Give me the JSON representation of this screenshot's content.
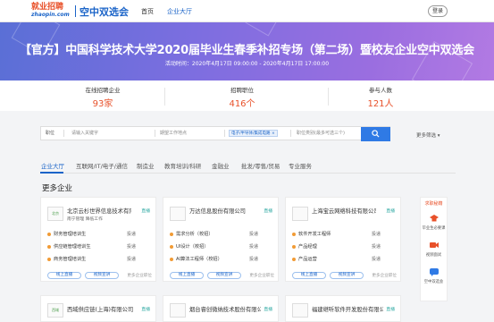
{
  "header": {
    "logo_top": "就业招聘",
    "logo_bottom": "zhaopin.com",
    "site_title": "空中双选会",
    "nav": [
      "首页",
      "企业大厅"
    ],
    "login": "登录"
  },
  "banner": {
    "title": "【官方】中国科学技术大学2020届毕业生春季补招专场（第二场）暨校友企业空中双选会",
    "time": "活动时间：2020年4月17日 09:00:00 - 2020年4月17日 17:00:00"
  },
  "stats": [
    {
      "label": "在线招聘企业",
      "value": "93家"
    },
    {
      "label": "招聘职位",
      "value": "416个"
    },
    {
      "label": "参与人数",
      "value": "121人"
    }
  ],
  "search": {
    "field1": "职位",
    "placeholder": "请输入关键字",
    "field2": "期望工作地点",
    "tag": "电子/半导体/集成电路",
    "tag_close": "×",
    "field3": "职位类别(最多可选三个)",
    "more_filter": "更多筛选"
  },
  "tabs": [
    "企业大厅",
    "互联网/IT/电子/通信",
    "制造业",
    "教育培训/科研",
    "金融业",
    "批发/零售/贸易",
    "专业服务"
  ],
  "section_title": "更多企业",
  "cards": [
    {
      "logo": "北京",
      "name": "北京云杉世界信息技术有限...",
      "badge": "直播",
      "tags": "南宁管理   降低工作",
      "jobs": [
        {
          "title": "财务管理培训生",
          "action": "投递"
        },
        {
          "title": "供应链管理培训生",
          "action": "投递"
        },
        {
          "title": "商务管理培训生",
          "action": "投递"
        }
      ],
      "chat": "线上直播",
      "video": "视频宣讲",
      "more": "更多企业职位"
    },
    {
      "logo": "",
      "name": "万达信息股份有限公司",
      "badge": "直播",
      "tags": "",
      "jobs": [
        {
          "title": "需求分析（校招）",
          "action": "投递"
        },
        {
          "title": "UI设计（校招）",
          "action": "投递"
        },
        {
          "title": "AI算法工程师（校招）",
          "action": "投递"
        }
      ],
      "chat": "线上直播",
      "video": "视频宣讲",
      "more": "更多企业职位"
    },
    {
      "logo": "",
      "name": "上海宝云网络科技有限公司",
      "badge": "直播",
      "tags": "",
      "jobs": [
        {
          "title": "软件开发工程师",
          "action": "投递"
        },
        {
          "title": "产品经理",
          "action": "投递"
        },
        {
          "title": "产品运营",
          "action": "投递"
        }
      ],
      "chat": "线上直播",
      "video": "视频宣讲",
      "more": "更多企业职位"
    }
  ],
  "bottom_cards": [
    {
      "logo": "西域",
      "name": "西域供应链(上海)有限公司",
      "badge": "直播"
    },
    {
      "logo": "",
      "name": "烟台睿创微纳技术股份有限公司",
      "badge": "直播"
    },
    {
      "logo": "",
      "name": "福建继听软件开发股份有限公司",
      "badge": "直播"
    }
  ],
  "side": {
    "head": "求职秘籍",
    "items": [
      "毕业生必要课",
      "视频面试",
      "空中双选会"
    ]
  },
  "colors": {
    "accent": "#1b64c8",
    "orange": "#e8512a",
    "teal": "#2aa7a1"
  }
}
